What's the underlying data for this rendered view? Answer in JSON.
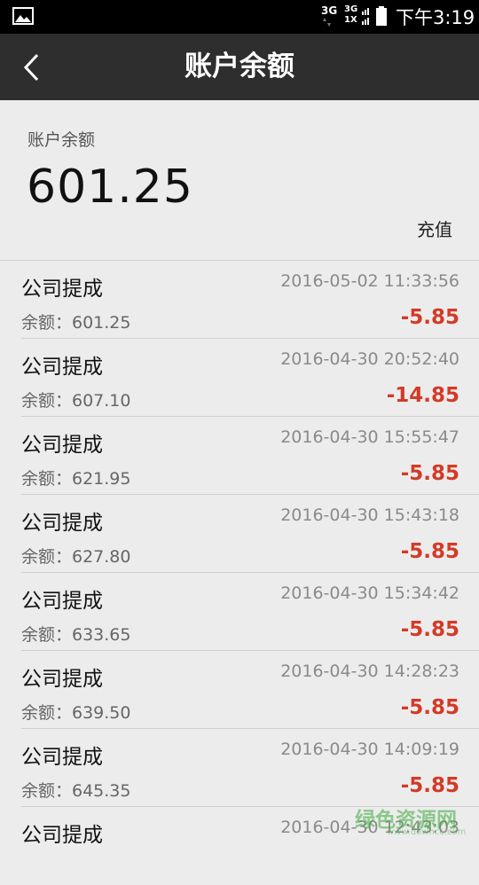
{
  "status_bar": {
    "net1": "3G",
    "net2_top": "3G",
    "net2_bottom": "1X",
    "time": "下午3:19"
  },
  "app_bar": {
    "title": "账户余额"
  },
  "summary": {
    "label": "账户余额",
    "amount": "601.25",
    "recharge_label": "充值"
  },
  "colors": {
    "header_bg": "#2e2e2e",
    "page_bg": "#ececec",
    "negative": "#d33a26"
  },
  "transactions": [
    {
      "type": "公司提成",
      "time": "2016-05-02 11:33:56",
      "balance": "余额：601.25",
      "change": "-5.85"
    },
    {
      "type": "公司提成",
      "time": "2016-04-30 20:52:40",
      "balance": "余额：607.10",
      "change": "-14.85"
    },
    {
      "type": "公司提成",
      "time": "2016-04-30 15:55:47",
      "balance": "余额：621.95",
      "change": "-5.85"
    },
    {
      "type": "公司提成",
      "time": "2016-04-30 15:43:18",
      "balance": "余额：627.80",
      "change": "-5.85"
    },
    {
      "type": "公司提成",
      "time": "2016-04-30 15:34:42",
      "balance": "余额：633.65",
      "change": "-5.85"
    },
    {
      "type": "公司提成",
      "time": "2016-04-30 14:28:23",
      "balance": "余额：639.50",
      "change": "-5.85"
    },
    {
      "type": "公司提成",
      "time": "2016-04-30 14:09:19",
      "balance": "余额：645.35",
      "change": "-5.85"
    },
    {
      "type": "公司提成",
      "time": "2016-04-30 12:43:03",
      "balance": "",
      "change": ""
    }
  ],
  "watermark": {
    "text": "绿色资源网",
    "url": "www.downcc.com"
  }
}
